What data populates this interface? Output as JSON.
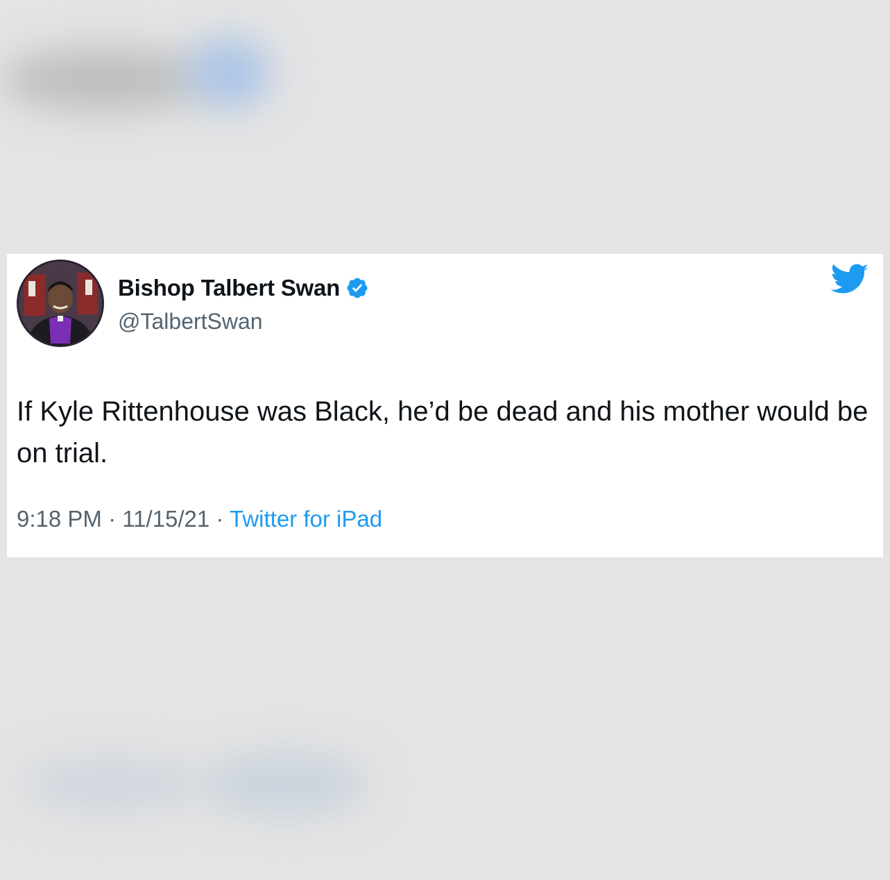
{
  "tweet": {
    "display_name": "Bishop Talbert Swan",
    "handle": "@TalbertSwan",
    "text": "If Kyle Rittenhouse was Black, he’d be dead and his mother would be on trial.",
    "time": "9:18 PM",
    "separator": " · ",
    "date": "11/15/21",
    "source": "Twitter for iPad",
    "verified": true
  },
  "icons": {
    "avatar": "profile-photo",
    "verified": "verified-badge-icon",
    "logo": "twitter-bird-icon"
  },
  "colors": {
    "twitter_blue": "#1d9bf0",
    "text_primary": "#0f1419",
    "text_secondary": "#536471",
    "card_bg": "#ffffff",
    "page_bg": "#e4e4e4"
  }
}
